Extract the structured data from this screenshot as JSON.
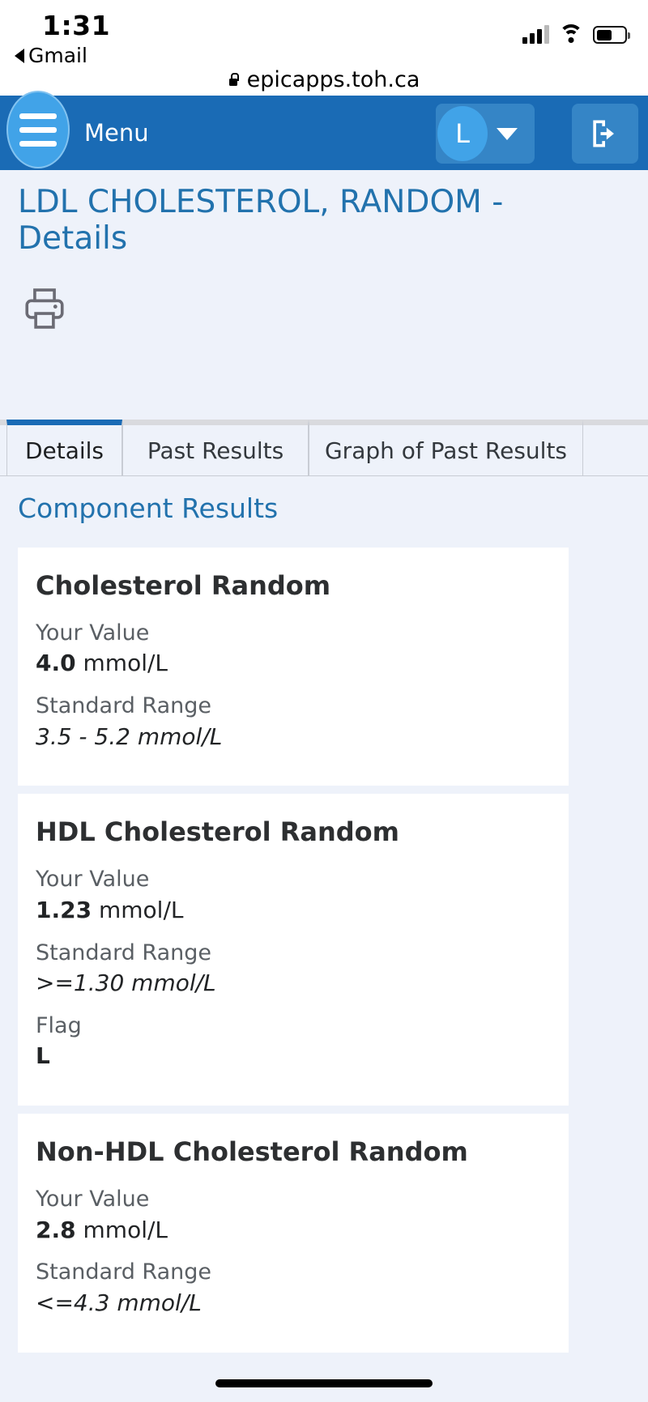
{
  "status_bar": {
    "time": "1:31",
    "back_label": "Gmail",
    "signal_icon": "cellular-signal-icon",
    "wifi_icon": "wifi-icon",
    "battery_icon": "battery-icon"
  },
  "browser": {
    "lock_icon": "lock-icon",
    "url": "epicapps.toh.ca"
  },
  "navbar": {
    "hamburger_icon": "hamburger-menu-icon",
    "menu_label": "Menu",
    "avatar_initial": "L",
    "dropdown_icon": "chevron-down-icon",
    "logout_icon": "logout-icon"
  },
  "page": {
    "title": "LDL CHOLESTEROL, RANDOM - Details",
    "print_icon": "printer-icon"
  },
  "tabs": [
    {
      "label": "Details",
      "active": true
    },
    {
      "label": "Past Results",
      "active": false
    },
    {
      "label": "Graph of Past Results",
      "active": false
    }
  ],
  "main": {
    "section_title": "Component Results",
    "labels": {
      "your_value": "Your Value",
      "standard_range": "Standard Range",
      "flag": "Flag"
    },
    "components": [
      {
        "name": "Cholesterol Random",
        "value_number": "4.0",
        "value_units": "mmol/L",
        "standard_range": "3.5 - 5.2 mmol/L",
        "flag": null
      },
      {
        "name": "HDL Cholesterol Random",
        "value_number": "1.23",
        "value_units": "mmol/L",
        "standard_range": ">=1.30 mmol/L",
        "flag": "L"
      },
      {
        "name": "Non-HDL Cholesterol Random",
        "value_number": "2.8",
        "value_units": "mmol/L",
        "standard_range": "<=4.3 mmol/L",
        "flag": null
      }
    ]
  },
  "colors": {
    "navbar": "#1a6bb5",
    "accent_blue": "#2272ad",
    "page_background": "#eef2fa",
    "card_background": "#ffffff"
  }
}
